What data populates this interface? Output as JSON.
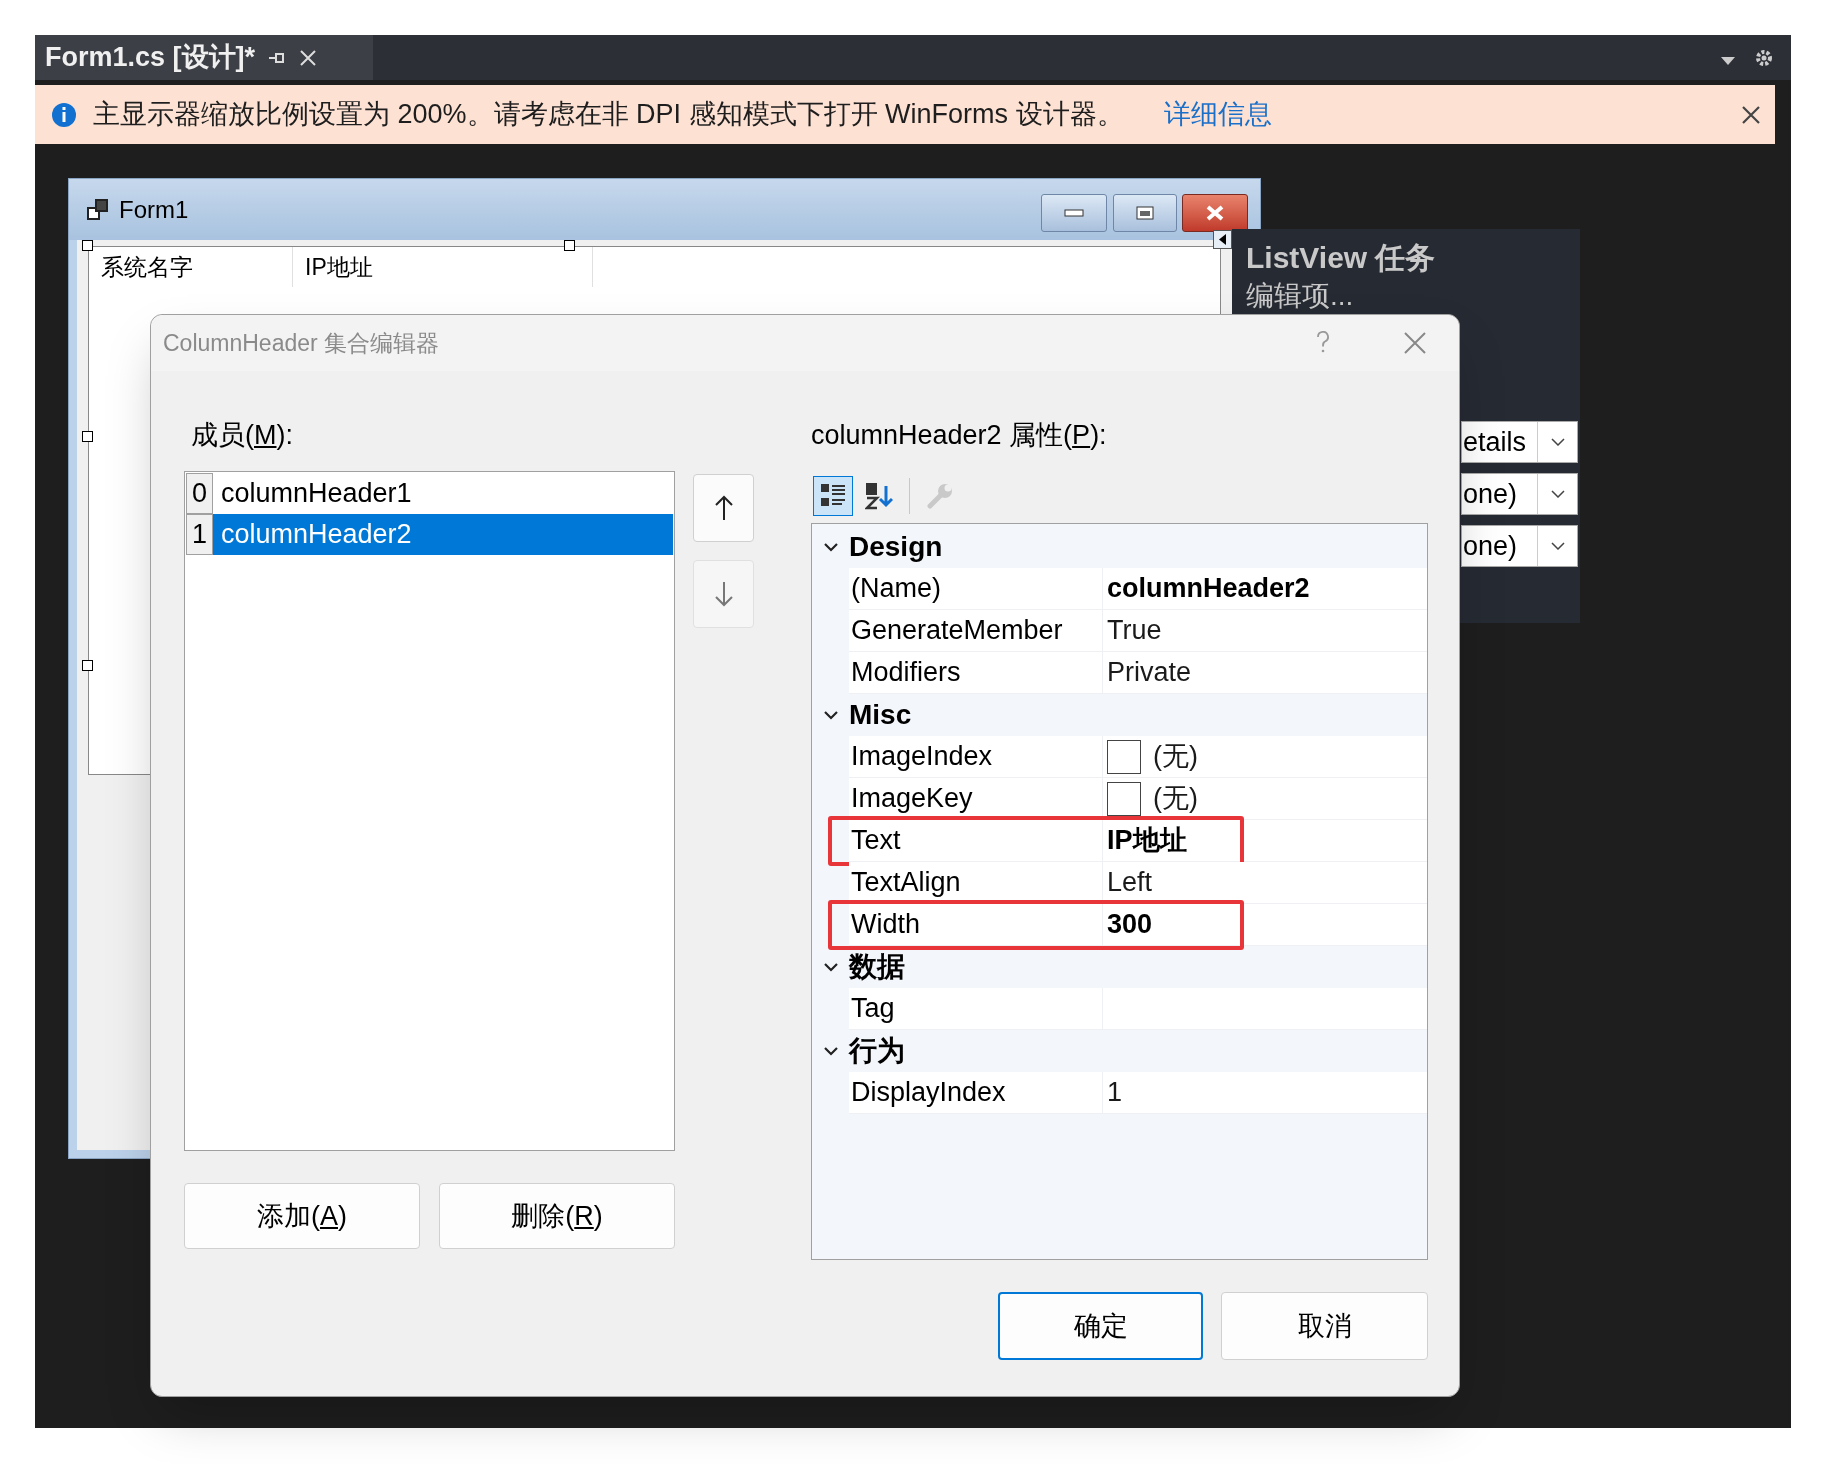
{
  "tab": {
    "title": "Form1.cs [设计]*"
  },
  "info_bar": {
    "message": "主显示器缩放比例设置为 200%。请考虑在非 DPI 感知模式下打开 WinForms 设计器。",
    "link": "详细信息"
  },
  "form": {
    "title": "Form1",
    "list_view": {
      "columns": [
        "系统名字",
        "IP地址"
      ]
    }
  },
  "tasks_panel": {
    "title": "ListView 任务",
    "link": "编辑项...",
    "dropdowns": [
      "etails",
      "one)",
      "one)"
    ]
  },
  "dialog": {
    "title": "ColumnHeader 集合编辑器",
    "members_label": {
      "before": "成员(",
      "key": "M",
      "after": "):"
    },
    "members": [
      {
        "index": "0",
        "name": "columnHeader1",
        "selected": false
      },
      {
        "index": "1",
        "name": "columnHeader2",
        "selected": true
      }
    ],
    "add_button": {
      "before": "添加(",
      "key": "A",
      "after": ")"
    },
    "remove_button": {
      "before": "删除(",
      "key": "R",
      "after": ")"
    },
    "properties_label": {
      "before": "columnHeader2 属性(",
      "key": "P",
      "after": "):"
    },
    "toolbar": [
      {
        "kind": "categorized",
        "selected": true,
        "disabled": false
      },
      {
        "kind": "alphabetical",
        "selected": false,
        "disabled": false
      },
      {
        "kind": "property-pages",
        "selected": false,
        "disabled": true
      }
    ],
    "properties": [
      {
        "kind": "category",
        "label": "Design",
        "expanded": true
      },
      {
        "kind": "property",
        "name": "(Name)",
        "value": "columnHeader2",
        "modified": true
      },
      {
        "kind": "property",
        "name": "GenerateMember",
        "value": "True",
        "modified": false
      },
      {
        "kind": "property",
        "name": "Modifiers",
        "value": "Private",
        "modified": false
      },
      {
        "kind": "category",
        "label": "Misc",
        "expanded": true
      },
      {
        "kind": "property",
        "name": "ImageIndex",
        "value": "(无)",
        "modified": false,
        "swatch": true
      },
      {
        "kind": "property",
        "name": "ImageKey",
        "value": "(无)",
        "modified": false,
        "swatch": true
      },
      {
        "kind": "property",
        "name": "Text",
        "value": "IP地址",
        "modified": true,
        "highlighted": true
      },
      {
        "kind": "property",
        "name": "TextAlign",
        "value": "Left",
        "modified": false
      },
      {
        "kind": "property",
        "name": "Width",
        "value": "300",
        "modified": true,
        "highlighted": true
      },
      {
        "kind": "category",
        "label": "数据",
        "expanded": true
      },
      {
        "kind": "property",
        "name": "Tag"
      },
      {
        "kind": "category",
        "label": "行为",
        "expanded": true
      },
      {
        "kind": "property",
        "name": "DisplayIndex",
        "value": "1",
        "modified": false
      }
    ],
    "ok_button": "确定",
    "cancel_button": "取消"
  }
}
